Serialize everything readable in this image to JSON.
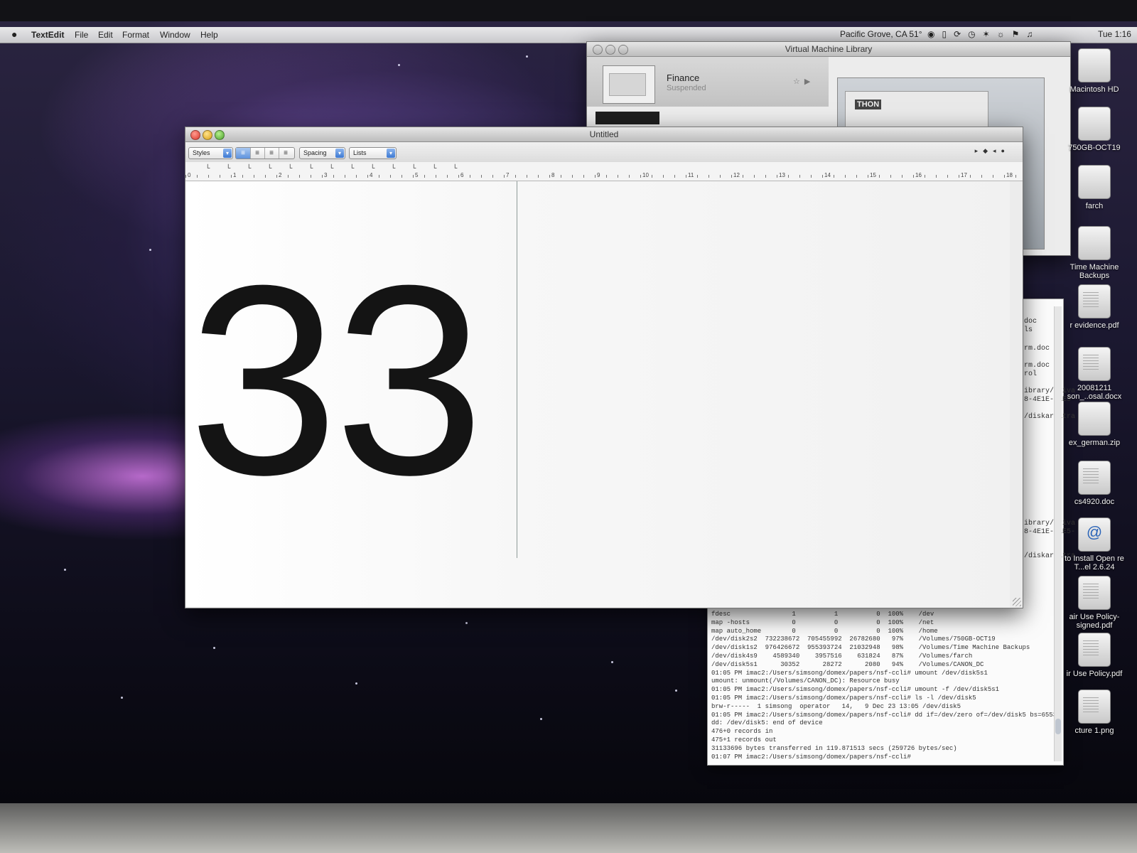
{
  "menubar": {
    "apple": "",
    "items": [
      "TextEdit",
      "File",
      "Edit",
      "Format",
      "Window",
      "Help"
    ],
    "weather": "Pacific Grove, CA 51°",
    "clock": "Tue 1:16"
  },
  "vm_library": {
    "title": "Virtual Machine Library",
    "vm_name": "Finance",
    "vm_state": "Suspended",
    "preview_label": "THON"
  },
  "textedit": {
    "title": "Untitled",
    "styles_label": "Styles",
    "spacing_label": "Spacing",
    "lists_label": "Lists",
    "ruler_numbers": [
      "0",
      "1",
      "2",
      "3",
      "4",
      "5",
      "6",
      "7",
      "8",
      "9",
      "10",
      "11",
      "12",
      "13",
      "14",
      "15",
      "16",
      "17",
      "18"
    ],
    "document_text": "33"
  },
  "terminal": {
    "fragments": [
      "doc",
      "ls",
      "rm.doc",
      "rm.doc",
      "rol",
      "ibrary/Priva",
      "8-4E1E-81E5-",
      "/diskarbitra",
      "ibrary/Priva",
      "8-4E1E-81E5-",
      "/diskarbitra"
    ],
    "lines": [
      "fdesc                1          1          0  100%    /dev",
      "map -hosts           0          0          0  100%    /net",
      "map auto_home        0          0          0  100%    /home",
      "/dev/disk2s2  732238672  705455992  26782680   97%    /Volumes/750GB-OCT19",
      "/dev/disk1s2  976426672  955393724  21032948   98%    /Volumes/Time Machine Backups",
      "/dev/disk4s9    4589340    3957516    631824   87%    /Volumes/farch",
      "/dev/disk5s1      30352      28272      2080   94%    /Volumes/CANON_DC",
      "01:05 PM imac2:/Users/simsong/domex/papers/nsf-ccli# umount /dev/disk5s1",
      "umount: unmount(/Volumes/CANON_DC): Resource busy",
      "01:05 PM imac2:/Users/simsong/domex/papers/nsf-ccli# umount -f /dev/disk5s1",
      "01:05 PM imac2:/Users/simsong/domex/papers/nsf-ccli# ls -l /dev/disk5",
      "brw-r-----  1 simsong  operator   14,   9 Dec 23 13:05 /dev/disk5",
      "01:05 PM imac2:/Users/simsong/domex/papers/nsf-ccli# dd if=/dev/zero of=/dev/disk5 bs=65536",
      "dd: /dev/disk5: end of device",
      "476+0 records in",
      "475+1 records out",
      "31133696 bytes transferred in 119.871513 secs (259726 bytes/sec)",
      "01:07 PM imac2:/Users/simsong/domex/papers/nsf-ccli# "
    ]
  },
  "desktop_icons": [
    {
      "label": "Macintosh HD",
      "icon": "hard-drive"
    },
    {
      "label": "750GB-OCT19",
      "icon": "firewire-drive"
    },
    {
      "label": "farch",
      "icon": "external-drive"
    },
    {
      "label": "Time Machine Backups",
      "icon": "time-machine"
    },
    {
      "label": "r evidence.pdf",
      "icon": "pdf-document"
    },
    {
      "label": "20081211 son_..osal.docx",
      "icon": "docx-document"
    },
    {
      "label": "ex_german.zip",
      "icon": "zip-archive"
    },
    {
      "label": "cs4920.doc",
      "icon": "doc-document"
    },
    {
      "label": "to Install Open re T...el 2.6.24",
      "icon": "web-location"
    },
    {
      "label": "air Use Policy-signed.pdf",
      "icon": "pdf-document"
    },
    {
      "label": "ir Use Policy.pdf",
      "icon": "pdf-document"
    },
    {
      "label": "cture 1.png",
      "icon": "image-file"
    }
  ]
}
